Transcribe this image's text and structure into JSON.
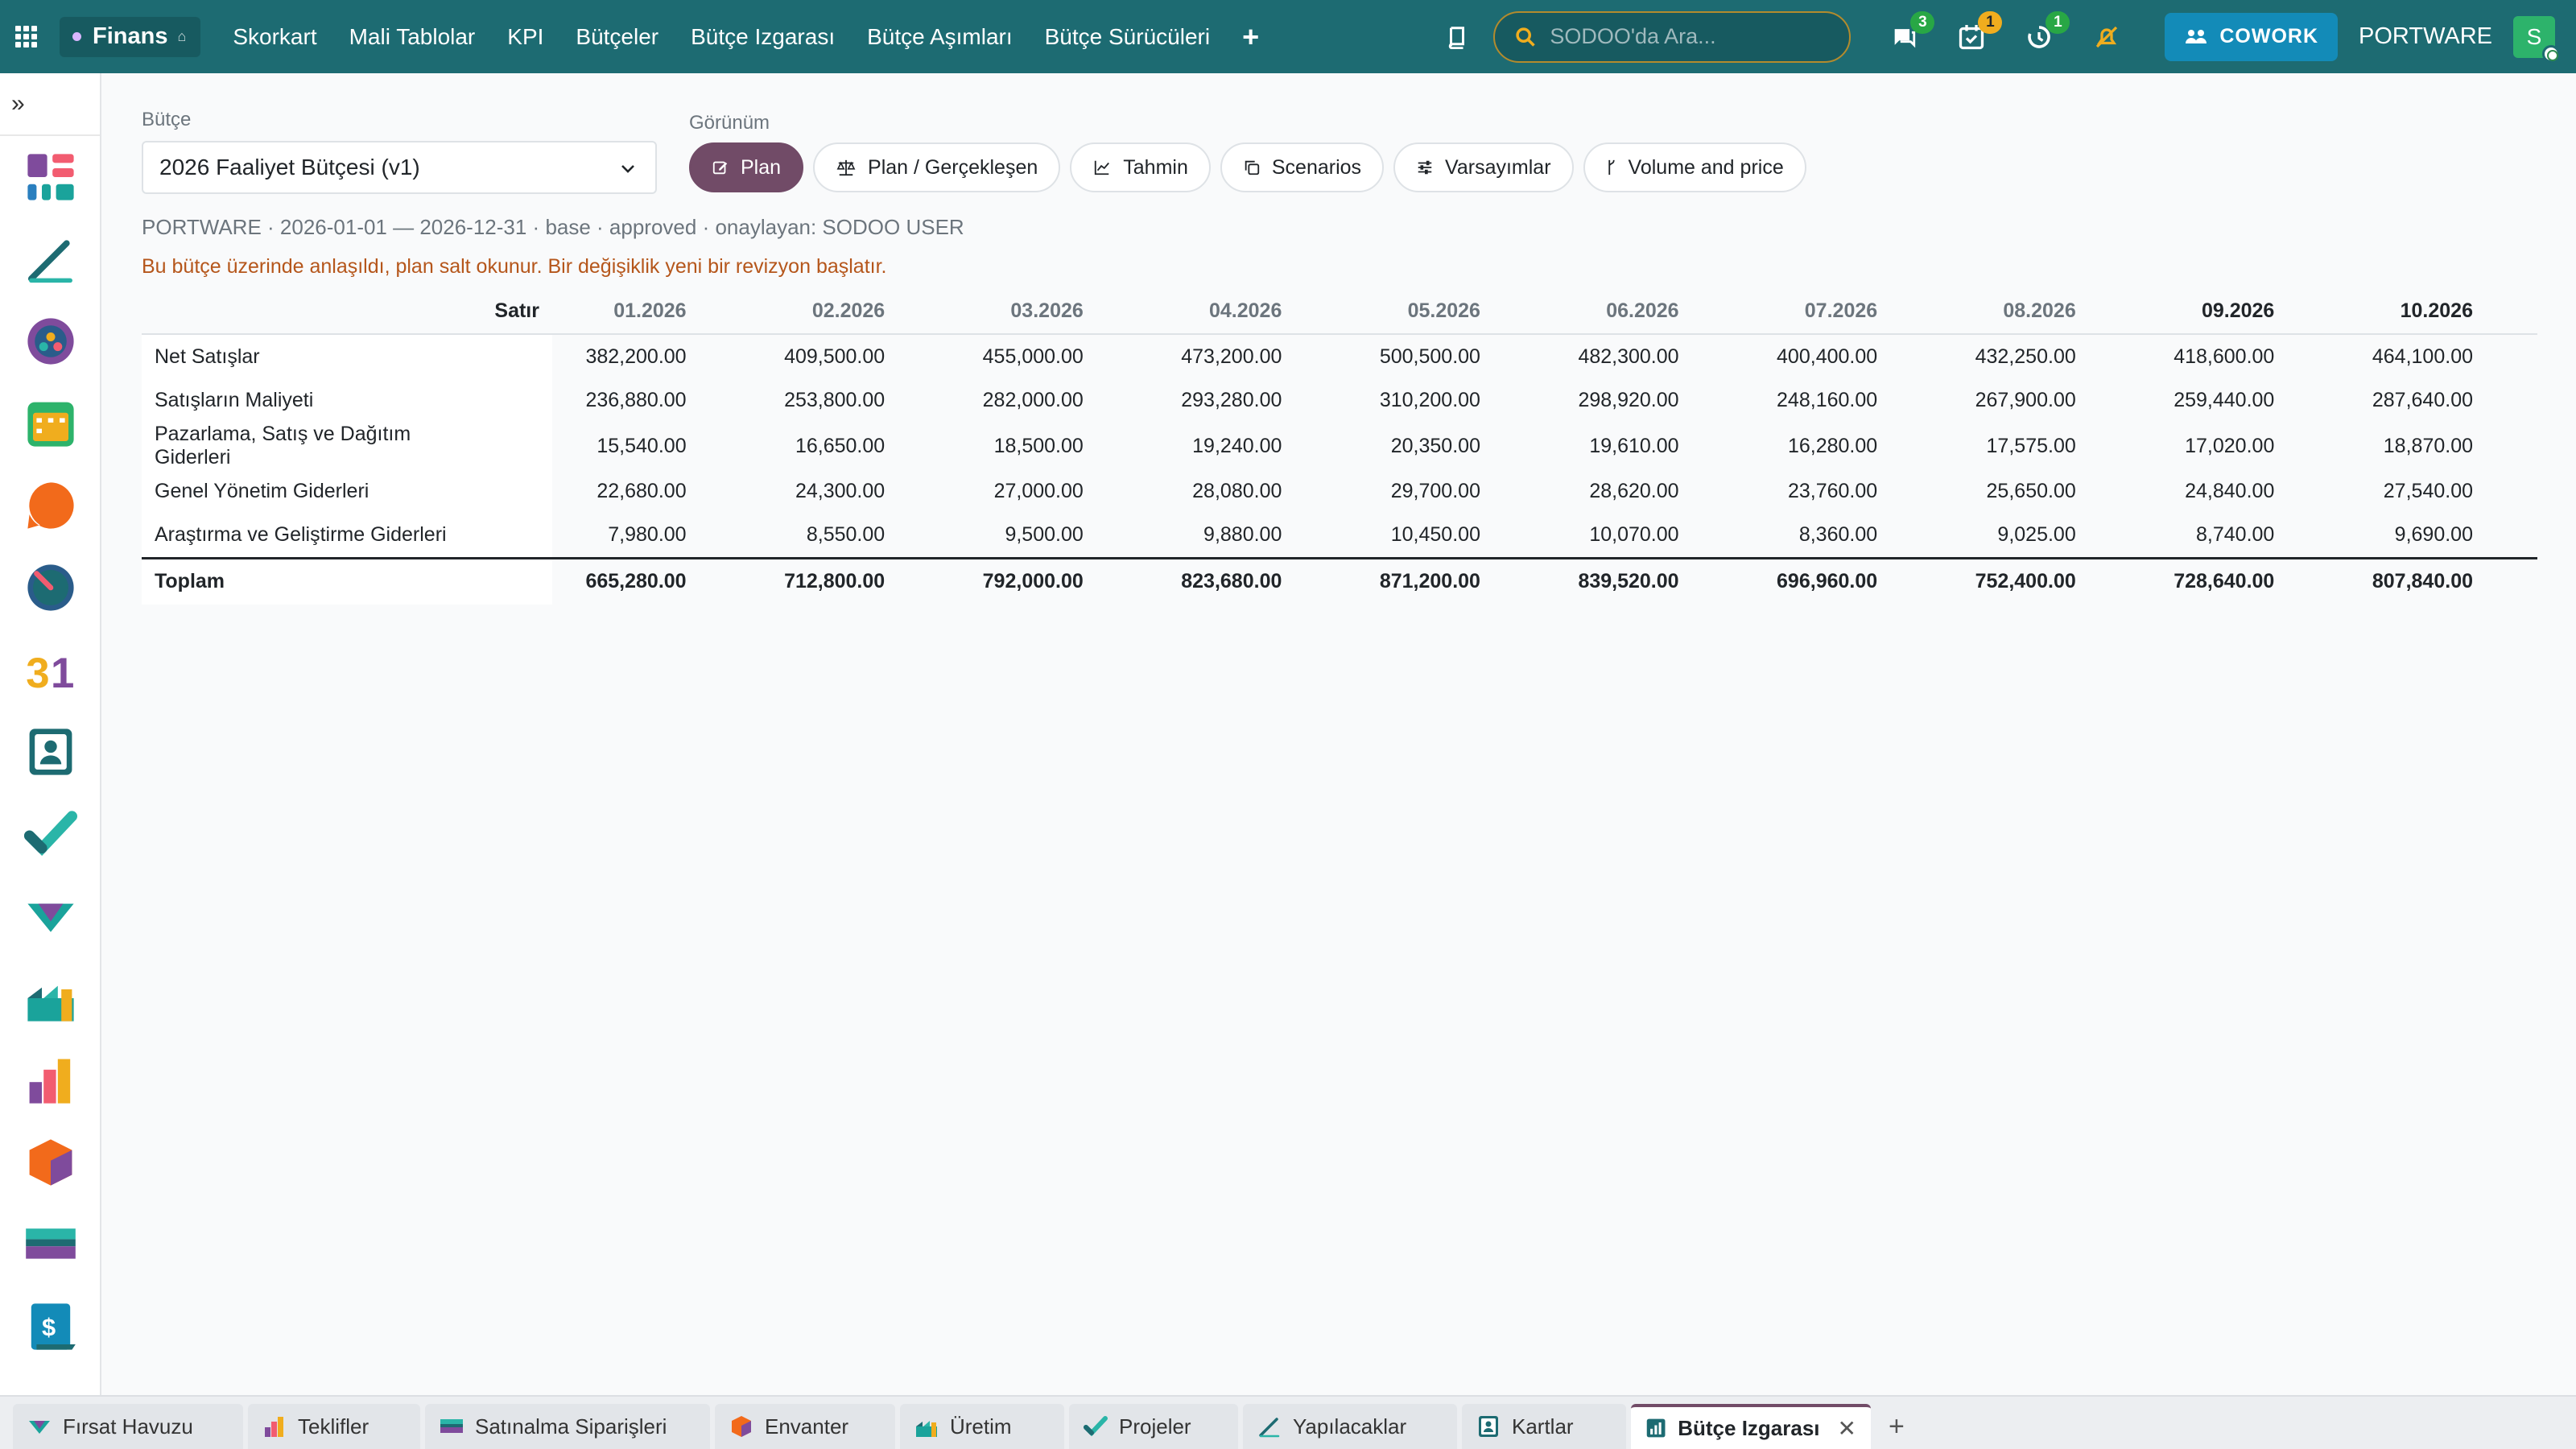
{
  "topbar": {
    "module": "Finans",
    "menu": [
      "Skorkart",
      "Mali Tablolar",
      "KPI",
      "Bütçeler",
      "Bütçe Izgarası",
      "Bütçe Aşımları",
      "Bütçe Sürücüleri"
    ],
    "add_label": "+",
    "search_placeholder": "SODOO'da Ara...",
    "badges": {
      "messages": "3",
      "activities": "1",
      "timer": "1"
    },
    "cowork_label": "COWORK",
    "company": "PORTWARE",
    "avatar_letter": "S",
    "colors": {
      "bar": "#1d6b72",
      "accent": "#714b67",
      "cowork": "#138bb8"
    }
  },
  "sidebar": {
    "apps": [
      "dashboard-app-icon",
      "notes-app-icon",
      "team-app-icon",
      "calendar-grid-app-icon",
      "discuss-app-icon",
      "time-app-icon",
      "calendar-31-app-icon",
      "contacts-app-icon",
      "todo-app-icon",
      "crm-app-icon",
      "manufacturing-app-icon",
      "sales-app-icon",
      "inventory-app-icon",
      "purchase-app-icon",
      "invoicing-app-icon"
    ]
  },
  "filters": {
    "budget_label": "Bütçe",
    "budget_value": "2026 Faaliyet Bütçesi (v1)",
    "view_label": "Görünüm",
    "views": [
      "Plan",
      "Plan / Gerçekleşen",
      "Tahmin",
      "Scenarios",
      "Varsayımlar",
      "Volume and price"
    ]
  },
  "meta_line": "PORTWARE · 2026-01-01 — 2026-12-31 · base · approved · onaylayan: SODOO USER",
  "warning": "Bu bütçe üzerinde anlaşıldı, plan salt okunur. Bir değişiklik yeni bir revizyon başlatır.",
  "grid": {
    "row_header": "Satır",
    "columns": [
      "01.2026",
      "02.2026",
      "03.2026",
      "04.2026",
      "05.2026",
      "06.2026",
      "07.2026",
      "08.2026",
      "09.2026",
      "10.2026"
    ],
    "rows": [
      {
        "name": "Net Satışlar",
        "values": [
          "382,200.00",
          "409,500.00",
          "455,000.00",
          "473,200.00",
          "500,500.00",
          "482,300.00",
          "400,400.00",
          "432,250.00",
          "418,600.00",
          "464,100.00"
        ]
      },
      {
        "name": "Satışların Maliyeti",
        "values": [
          "236,880.00",
          "253,800.00",
          "282,000.00",
          "293,280.00",
          "310,200.00",
          "298,920.00",
          "248,160.00",
          "267,900.00",
          "259,440.00",
          "287,640.00"
        ]
      },
      {
        "name": "Pazarlama, Satış ve Dağıtım Giderleri",
        "values": [
          "15,540.00",
          "16,650.00",
          "18,500.00",
          "19,240.00",
          "20,350.00",
          "19,610.00",
          "16,280.00",
          "17,575.00",
          "17,020.00",
          "18,870.00"
        ]
      },
      {
        "name": "Genel Yönetim Giderleri",
        "values": [
          "22,680.00",
          "24,300.00",
          "27,000.00",
          "28,080.00",
          "29,700.00",
          "28,620.00",
          "23,760.00",
          "25,650.00",
          "24,840.00",
          "27,540.00"
        ]
      },
      {
        "name": "Araştırma ve Geliştirme Giderleri",
        "values": [
          "7,980.00",
          "8,550.00",
          "9,500.00",
          "9,880.00",
          "10,450.00",
          "10,070.00",
          "8,360.00",
          "9,025.00",
          "8,740.00",
          "9,690.00"
        ]
      }
    ],
    "total": {
      "name": "Toplam",
      "values": [
        "665,280.00",
        "712,800.00",
        "792,000.00",
        "823,680.00",
        "871,200.00",
        "839,520.00",
        "696,960.00",
        "752,400.00",
        "728,640.00",
        "807,840.00"
      ]
    }
  },
  "bottom_tabs": {
    "tabs": [
      "Fırsat Havuzu",
      "Teklifler",
      "Satınalma Siparişleri",
      "Envanter",
      "Üretim",
      "Projeler",
      "Yapılacaklar",
      "Kartlar",
      "Bütçe Izgarası"
    ],
    "active": "Bütçe Izgarası",
    "close_label": "✕",
    "add_label": "+"
  }
}
